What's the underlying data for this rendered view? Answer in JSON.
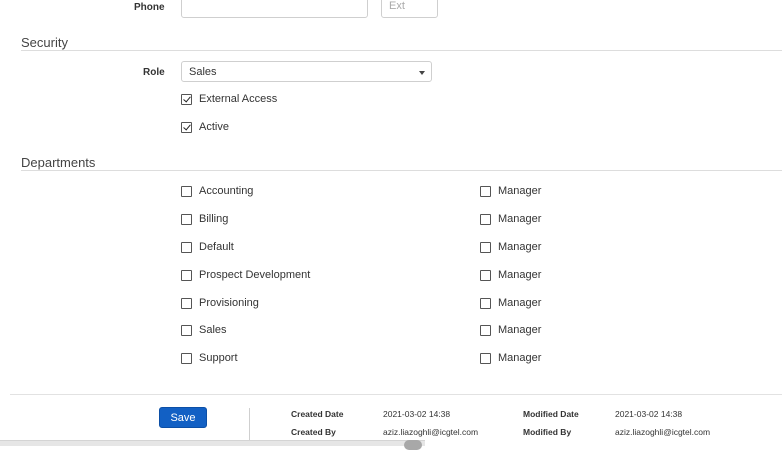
{
  "contact": {
    "phone_label": "Phone",
    "phone_value": "",
    "ext_placeholder": "Ext"
  },
  "security": {
    "title": "Security",
    "role_label": "Role",
    "role_value": "Sales",
    "external_access_label": "External Access",
    "external_access_checked": true,
    "active_label": "Active",
    "active_checked": true
  },
  "departments": {
    "title": "Departments",
    "items": [
      {
        "name": "Accounting",
        "checked": false,
        "manager_label": "Manager",
        "manager_checked": false
      },
      {
        "name": "Billing",
        "checked": false,
        "manager_label": "Manager",
        "manager_checked": false
      },
      {
        "name": "Default",
        "checked": false,
        "manager_label": "Manager",
        "manager_checked": false
      },
      {
        "name": "Prospect Development",
        "checked": false,
        "manager_label": "Manager",
        "manager_checked": false
      },
      {
        "name": "Provisioning",
        "checked": false,
        "manager_label": "Manager",
        "manager_checked": false
      },
      {
        "name": "Sales",
        "checked": false,
        "manager_label": "Manager",
        "manager_checked": false
      },
      {
        "name": "Support",
        "checked": false,
        "manager_label": "Manager",
        "manager_checked": false
      }
    ]
  },
  "footer": {
    "save_label": "Save",
    "created_date_label": "Created Date",
    "created_date_value": "2021-03-02 14:38",
    "created_by_label": "Created By",
    "created_by_value": "aziz.liazoghli@icgtel.com",
    "modified_date_label": "Modified Date",
    "modified_date_value": "2021-03-02 14:38",
    "modified_by_label": "Modified By",
    "modified_by_value": "aziz.liazoghli@icgtel.com"
  },
  "colors": {
    "accent": "#1260c4",
    "rule": "#dddddd"
  }
}
